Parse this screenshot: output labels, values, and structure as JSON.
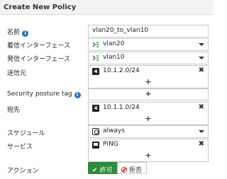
{
  "dialog": {
    "title": "Create New Policy"
  },
  "fields": {
    "name": {
      "label": "名前",
      "value": "vlan20_to_vlan10"
    },
    "incoming_interface": {
      "label": "着信インターフェース",
      "value": "vlan20"
    },
    "outgoing_interface": {
      "label": "発信インターフェース",
      "value": "vlan10"
    },
    "source": {
      "label": "送信元",
      "value": "10.1.2.0/24"
    },
    "security_posture_tag": {
      "label": "Security posture tag",
      "value": ""
    },
    "destination": {
      "label": "宛先",
      "value": "10.1.1.0/24"
    },
    "schedule": {
      "label": "スケジュール",
      "value": "always"
    },
    "service": {
      "label": "サービス",
      "value": "PING"
    },
    "action": {
      "label": "アクション",
      "accept_label": "許可",
      "deny_label": "拒否",
      "selected": "accept"
    }
  },
  "glyphs": {
    "remove": "✖",
    "add": "+",
    "check": "✔",
    "info": "i",
    "address_icon_letter": "4"
  },
  "icons": {
    "interface": "interface-icon",
    "address": "address-icon",
    "schedule": "schedule-icon",
    "service": "service-icon",
    "info": "info-icon",
    "deny": "deny-icon"
  },
  "colors": {
    "accent": "#2d70c4",
    "accept": "#2e8b3a",
    "deny": "#cc2e2e",
    "interface_icon": "#3a9a3a"
  }
}
